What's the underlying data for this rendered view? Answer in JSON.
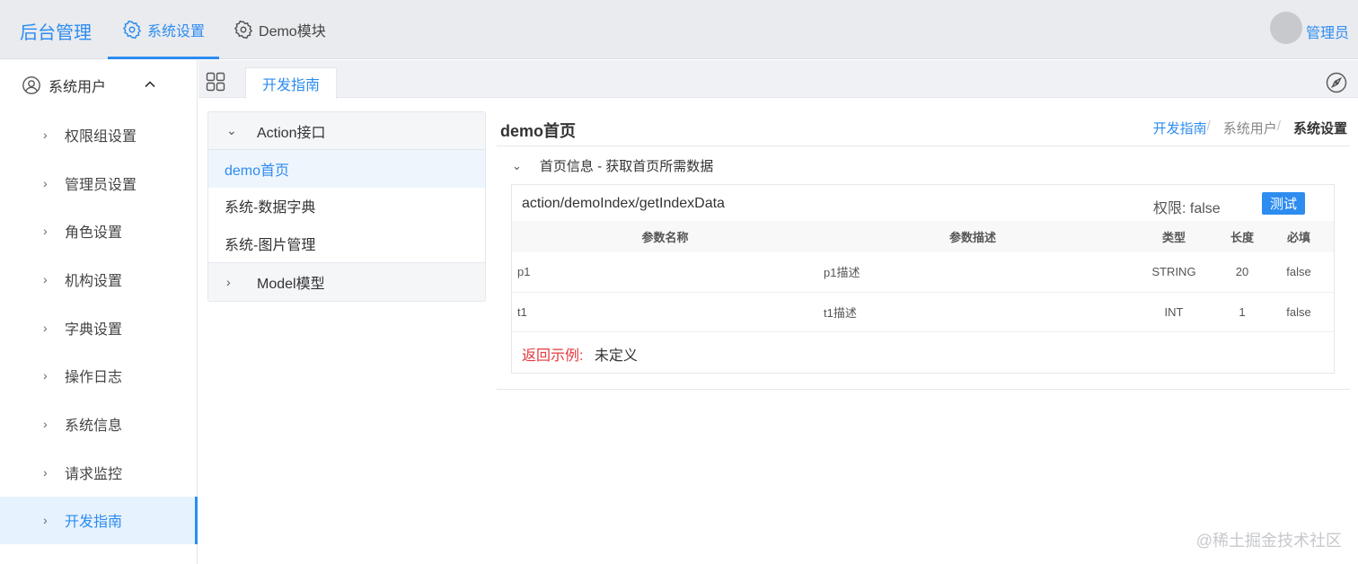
{
  "header": {
    "brand": "后台管理",
    "nav": [
      {
        "label": "系统设置",
        "icon": "gear-icon",
        "active": true
      },
      {
        "label": "Demo模块",
        "icon": "gear-icon",
        "active": false
      }
    ],
    "user_name": "管理员"
  },
  "sidebar": {
    "group_label": "系统用户",
    "items": [
      {
        "label": "权限组设置"
      },
      {
        "label": "管理员设置"
      },
      {
        "label": "角色设置"
      },
      {
        "label": "机构设置"
      },
      {
        "label": "字典设置"
      },
      {
        "label": "操作日志"
      },
      {
        "label": "系统信息"
      },
      {
        "label": "请求监控"
      },
      {
        "label": "开发指南",
        "active": true
      }
    ]
  },
  "tabs": [
    {
      "label": "开发指南",
      "active": true
    }
  ],
  "tree": {
    "group1": "Action接口",
    "items": [
      "demo首页",
      "系统-数据字典",
      "系统-图片管理"
    ],
    "group2": "Model模型"
  },
  "page": {
    "title": "demo首页",
    "breadcrumb": [
      "开发指南",
      "系统用户",
      "系统设置"
    ],
    "section_title": "首页信息 - 获取首页所需数据",
    "api_path": "action/demoIndex/getIndexData",
    "permission": "权限: false",
    "test_button": "测试",
    "table": {
      "headers": [
        "参数名称",
        "参数描述",
        "类型",
        "长度",
        "必填"
      ],
      "rows": [
        [
          "p1",
          "p1描述",
          "STRING",
          "20",
          "false"
        ],
        [
          "t1",
          "t1描述",
          "INT",
          "1",
          "false"
        ]
      ]
    },
    "return_label": "返回示例:",
    "return_value": "未定义"
  },
  "watermark": "@稀土掘金技术社区",
  "colors": {
    "accent": "#2d8cf0",
    "header_bg": "#e9ebef",
    "danger": "#e4393c"
  }
}
